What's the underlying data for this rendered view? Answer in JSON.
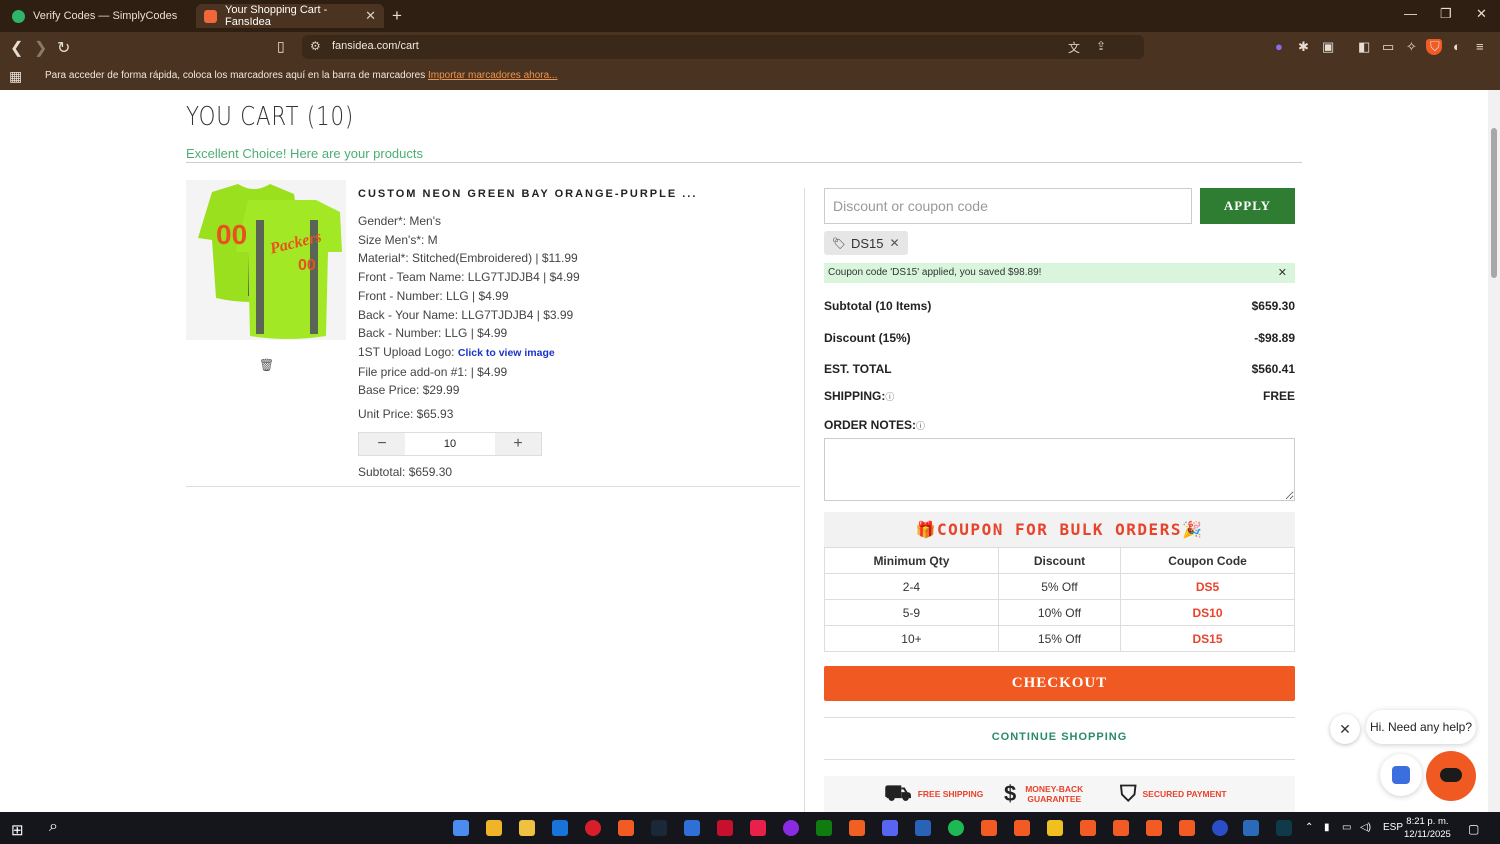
{
  "browser": {
    "tabs": [
      {
        "title": "Verify Codes — SimplyCodes",
        "active": false
      },
      {
        "title": "Your Shopping Cart - FansIdea",
        "active": true
      }
    ],
    "url": "fansidea.com/cart",
    "bookmarks_message": "Para acceder de forma rápida, coloca los marcadores aquí en la barra de marcadores",
    "bookmarks_link": "Importar marcadores ahora..."
  },
  "cart": {
    "title": "YOU CART (10)",
    "subtitle": "Excellent Choice! Here are your products",
    "item": {
      "name": "CUSTOM NEON GREEN BAY ORANGE-PURPLE ...",
      "lines": [
        "Gender*: Men's",
        "Size Men's*: M",
        "Material*: Stitched(Embroidered) | $11.99",
        "Front - Team Name: LLG7TJDJB4 | $4.99",
        "Front - Number: LLG | $4.99",
        "Back - Your Name: LLG7TJDJB4 | $3.99",
        "Back - Number: LLG | $4.99"
      ],
      "upload_label": "1ST Upload Logo:",
      "upload_link": "Click to view image",
      "lines_after": [
        "File price add-on #1: | $4.99",
        "Base Price: $29.99"
      ],
      "unit_price": "Unit Price: $65.93",
      "quantity": "10",
      "subtotal": "Subtotal: $659.30",
      "jersey_text": "Packers",
      "jersey_number": "00"
    }
  },
  "summary": {
    "coupon_placeholder": "Discount or coupon code",
    "apply_label": "APPLY",
    "applied_code": "DS15",
    "alert": "Coupon code 'DS15' applied, you saved $98.89!",
    "rows": [
      {
        "label": "Subtotal (10 Items)",
        "value": "$659.30"
      },
      {
        "label": "Discount (15%)",
        "value": "-$98.89"
      },
      {
        "label": "EST. TOTAL",
        "value": "$560.41"
      }
    ],
    "shipping_label": "SHIPPING:",
    "shipping_value": "FREE",
    "notes_label": "ORDER NOTES:",
    "bulk_title": "COUPON FOR BULK ORDERS",
    "bulk_headers": [
      "Minimum Qty",
      "Discount",
      "Coupon Code"
    ],
    "bulk_rows": [
      [
        "2-4",
        "5% Off",
        "DS5"
      ],
      [
        "5-9",
        "10% Off",
        "DS10"
      ],
      [
        "10+",
        "15% Off",
        "DS15"
      ]
    ],
    "checkout_label": "CHECKOUT",
    "continue_label": "CONTINUE SHOPPING",
    "trust": [
      "FREE SHIPPING",
      "MONEY-BACK GUARANTEE",
      "SECURED PAYMENT"
    ]
  },
  "chat": {
    "greeting": "Hi. Need any help?"
  },
  "taskbar": {
    "language": "ESP",
    "time": "8:21 p. m.",
    "date": "12/11/2025"
  },
  "colors": {
    "accent_orange": "#f05a22",
    "apply_green": "#2e7d32",
    "coupon_red": "#e8432b",
    "subtitle_green": "#4caf72"
  }
}
